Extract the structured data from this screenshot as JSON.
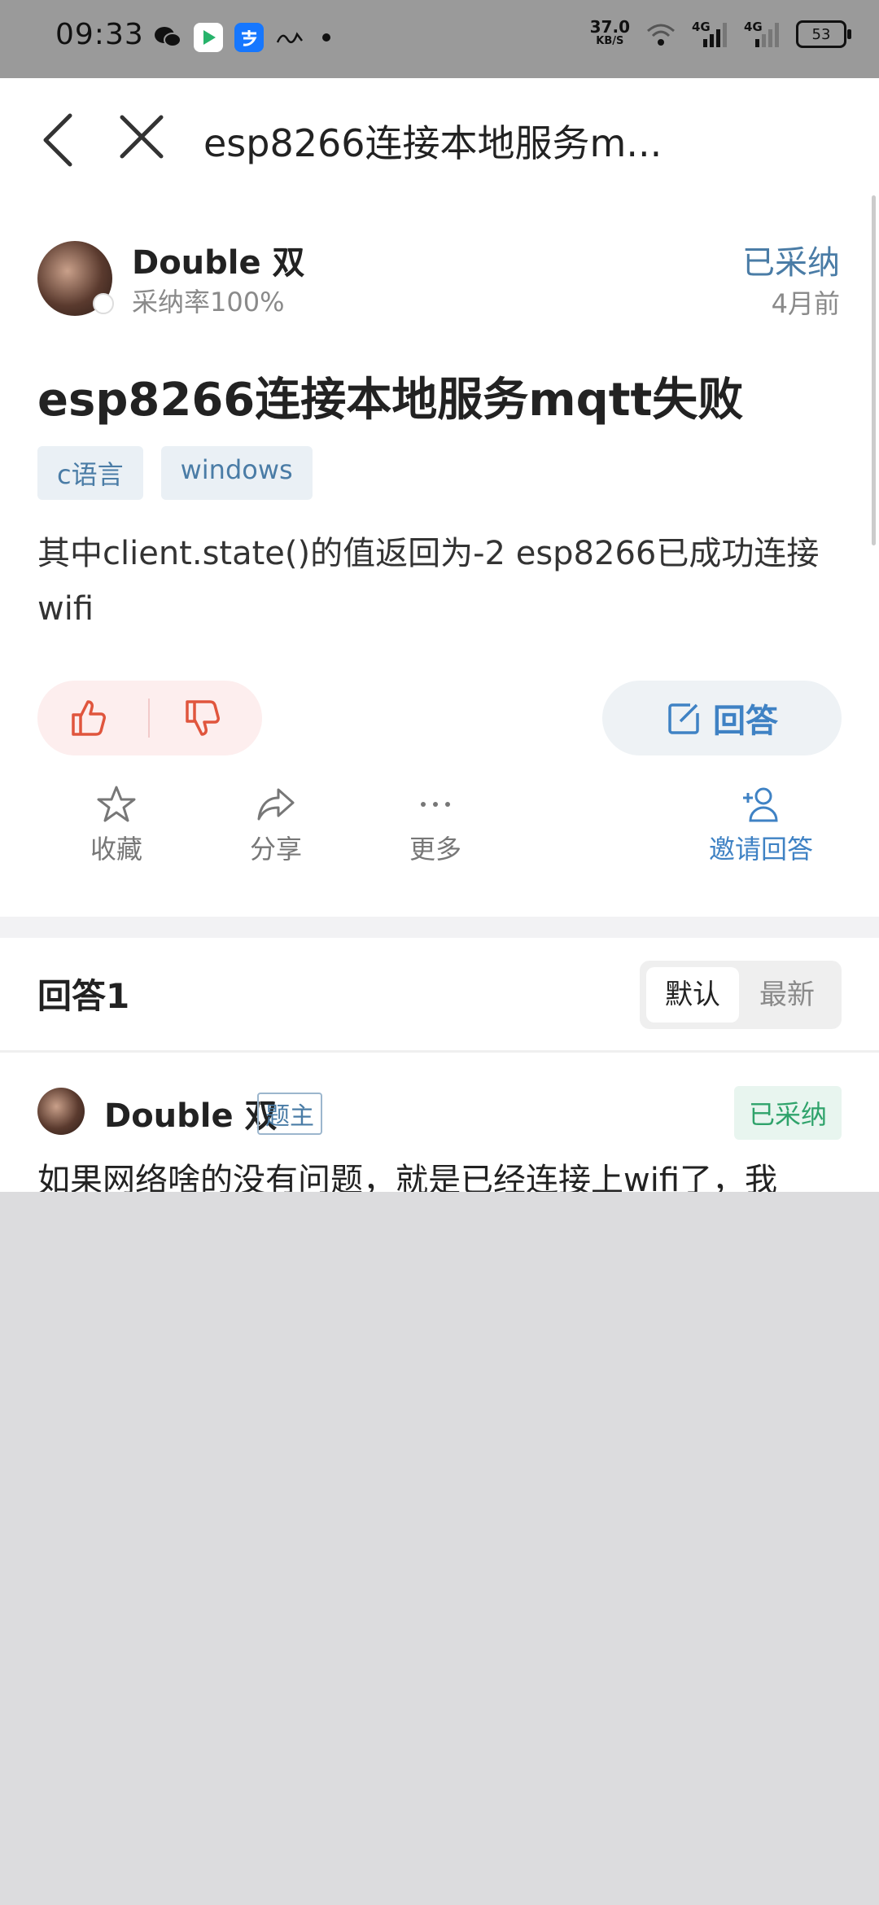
{
  "status_bar": {
    "time": "09:33",
    "net_speed": "37.0",
    "net_unit": "KB/S",
    "signal1": "4G",
    "signal2": "4G",
    "battery": "53"
  },
  "nav": {
    "title": "esp8266连接本地服务m..."
  },
  "question": {
    "author_name": "Double 双",
    "author_rate": "采纳率100%",
    "status": "已采纳",
    "time_ago": "4月前",
    "title": "esp8266连接本地服务mqtt失败",
    "tags": [
      "c语言",
      "windows"
    ],
    "body": "其中client.state()的值返回为-2 esp8266已成功连接wifi"
  },
  "buttons": {
    "answer": "回答"
  },
  "actions": {
    "favorite": "收藏",
    "share": "分享",
    "more": "更多",
    "invite": "邀请回答"
  },
  "answers": {
    "count_label": "回答1",
    "sort_default": "默认",
    "sort_latest": "最新",
    "items": [
      {
        "name": "Double 双",
        "owner_tag": "题主",
        "accepted": "已采纳",
        "text": "如果网络啥的没有问题，就是已经连接上wifi了，我"
      }
    ]
  },
  "colors": {
    "accent_blue": "#3f82c4",
    "vote_red": "#e0553d",
    "accepted_green": "#2fa36b"
  }
}
